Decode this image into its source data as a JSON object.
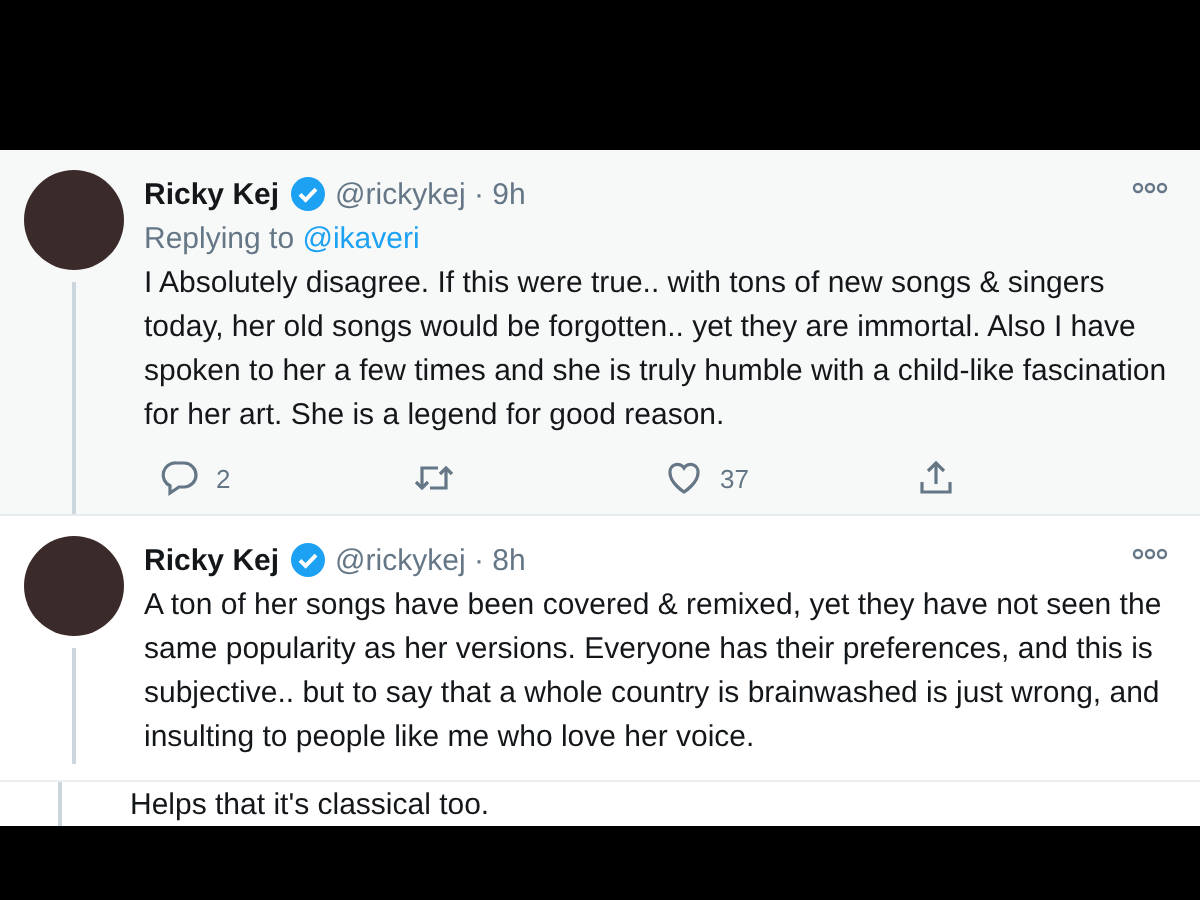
{
  "tweets": [
    {
      "name": "Ricky Kej",
      "verified": true,
      "handle_time": "@rickykej · 9h",
      "highlighted": true,
      "replying_to": {
        "label": "Replying to",
        "handle": "@ikaveri"
      },
      "text": "I Absolutely disagree. If this were true.. with tons of new songs & singers today, her old songs would be forgotten.. yet they are immortal. Also I have spoken to her a few times and she is truly humble with a child-like fascination for her art. She is a legend for good reason.",
      "actions": {
        "replies": "2",
        "likes": "37"
      }
    },
    {
      "name": "Ricky Kej",
      "verified": true,
      "handle_time": "@rickykej · 8h",
      "highlighted": false,
      "text": "A ton of her songs have been covered & remixed, yet they have not seen the same popularity as her versions. Everyone has their preferences, and this is subjective.. but to say that a whole country is brainwashed is just wrong, and insulting to people like me who love her voice."
    }
  ],
  "partial_tweet": {
    "text": "Helps that it's classical too."
  }
}
